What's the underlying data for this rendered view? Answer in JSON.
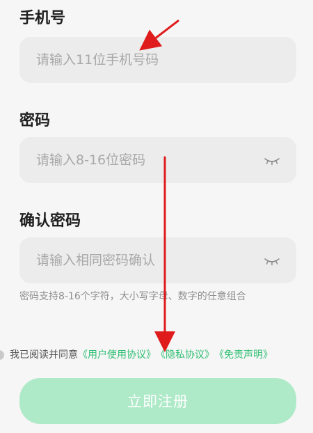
{
  "phone": {
    "label": "手机号",
    "placeholder": "请输入11位手机号码"
  },
  "password": {
    "label": "密码",
    "placeholder": "请输入8-16位密码",
    "toggle_icon": "eye-closed-icon"
  },
  "confirm": {
    "label": "确认密码",
    "placeholder": "请输入相同密码确认",
    "toggle_icon": "eye-closed-icon"
  },
  "password_hint": "密码支持8-16个字符，大小写字母、数字的任意组合",
  "agreement": {
    "prefix": "我已阅读并同意",
    "links": [
      "《用户使用协议》",
      "《隐私协议》",
      "《免责声明》"
    ]
  },
  "register_label": "立即注册",
  "colors": {
    "background": "#f6f6f6",
    "field": "#ececec",
    "link": "#2fbf72",
    "button_disabled": "#aeeac8",
    "annotation_arrow": "#e01b1b"
  }
}
